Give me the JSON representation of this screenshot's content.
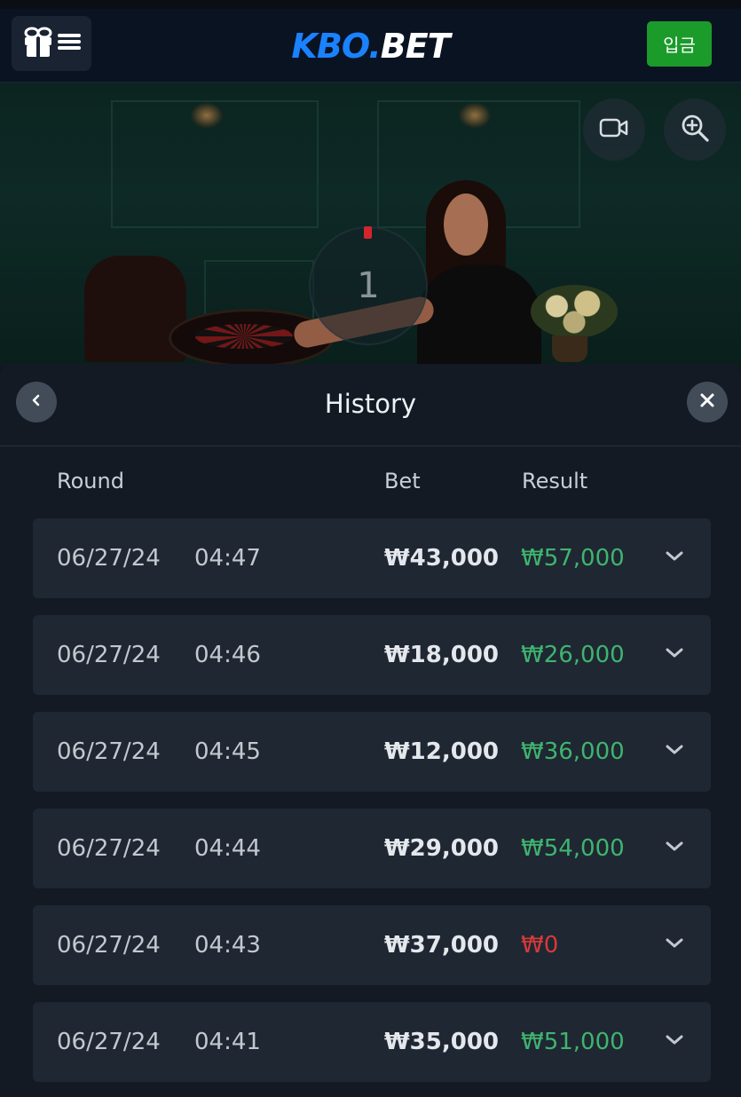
{
  "header": {
    "logo_part1": "KBO.",
    "logo_part2": "BET",
    "deposit_label": "입금"
  },
  "video": {
    "countdown": "1"
  },
  "history": {
    "title": "History",
    "columns": {
      "round": "Round",
      "bet": "Bet",
      "result": "Result"
    },
    "rows": [
      {
        "date": "06/27/24",
        "time": "04:47",
        "bet": "₩43,000",
        "result": "₩57,000",
        "outcome": "win"
      },
      {
        "date": "06/27/24",
        "time": "04:46",
        "bet": "₩18,000",
        "result": "₩26,000",
        "outcome": "win"
      },
      {
        "date": "06/27/24",
        "time": "04:45",
        "bet": "₩12,000",
        "result": "₩36,000",
        "outcome": "win"
      },
      {
        "date": "06/27/24",
        "time": "04:44",
        "bet": "₩29,000",
        "result": "₩54,000",
        "outcome": "win"
      },
      {
        "date": "06/27/24",
        "time": "04:43",
        "bet": "₩37,000",
        "result": "₩0",
        "outcome": "loss"
      },
      {
        "date": "06/27/24",
        "time": "04:41",
        "bet": "₩35,000",
        "result": "₩51,000",
        "outcome": "win"
      }
    ]
  },
  "icons": {
    "gift": "gift-icon",
    "menu": "menu-icon",
    "camera": "video-camera-icon",
    "zoom": "zoom-in-icon",
    "back": "chevron-left-icon",
    "close": "close-icon",
    "expand": "chevron-down-icon"
  },
  "colors": {
    "brand_blue": "#1a82ff",
    "deposit_green": "#1a9b2a",
    "win_green": "#3fb46f",
    "loss_red": "#d23a3a",
    "timer_red": "#d2252e"
  }
}
